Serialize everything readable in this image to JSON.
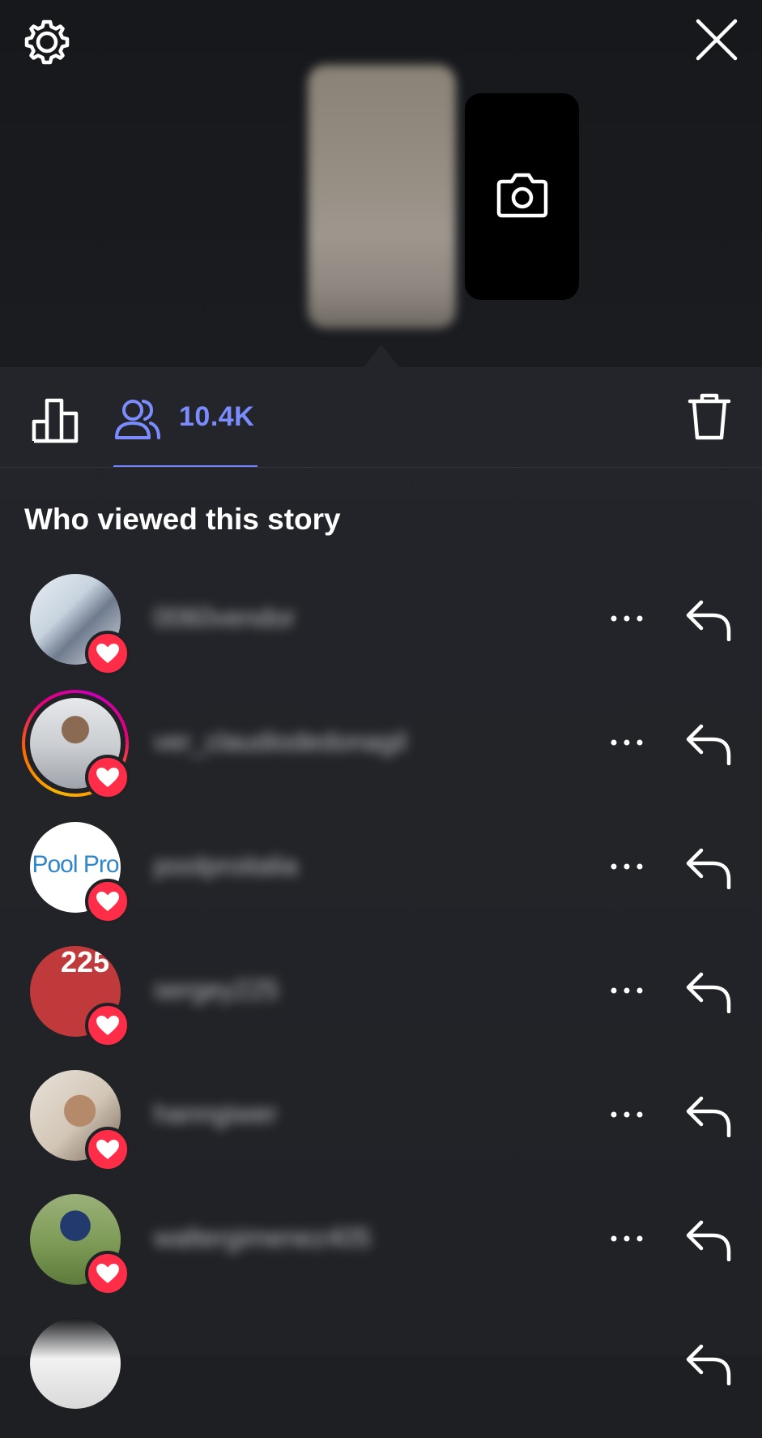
{
  "header": {
    "settings_icon": "gear-icon",
    "close_icon": "close-icon",
    "add_story_icon": "camera-icon"
  },
  "tabs": {
    "insights_icon": "bar-chart-icon",
    "viewers_icon": "users-icon",
    "viewer_count": "10.4K",
    "delete_icon": "trash-icon",
    "accent_color": "#6f83ff"
  },
  "viewers": {
    "title": "Who viewed this story",
    "items": [
      {
        "username": "0060vendor",
        "avatar": "photo",
        "liked": true,
        "story_ring": false
      },
      {
        "username": "ver_claudiodedonagil",
        "avatar": "photo",
        "liked": true,
        "story_ring": true
      },
      {
        "username": "poolproitalia",
        "avatar": "logo",
        "avatar_text": "Pool Pro",
        "liked": true,
        "story_ring": false
      },
      {
        "username": "sergey225",
        "avatar": "logo",
        "avatar_text": "225",
        "liked": true,
        "story_ring": false
      },
      {
        "username": "hanngiwer",
        "avatar": "photo",
        "liked": true,
        "story_ring": false
      },
      {
        "username": "waltergimenez405",
        "avatar": "photo",
        "liked": true,
        "story_ring": false
      },
      {
        "username": "",
        "avatar": "photo",
        "liked": false,
        "story_ring": false
      }
    ],
    "heart_color": "#ff2d48"
  }
}
